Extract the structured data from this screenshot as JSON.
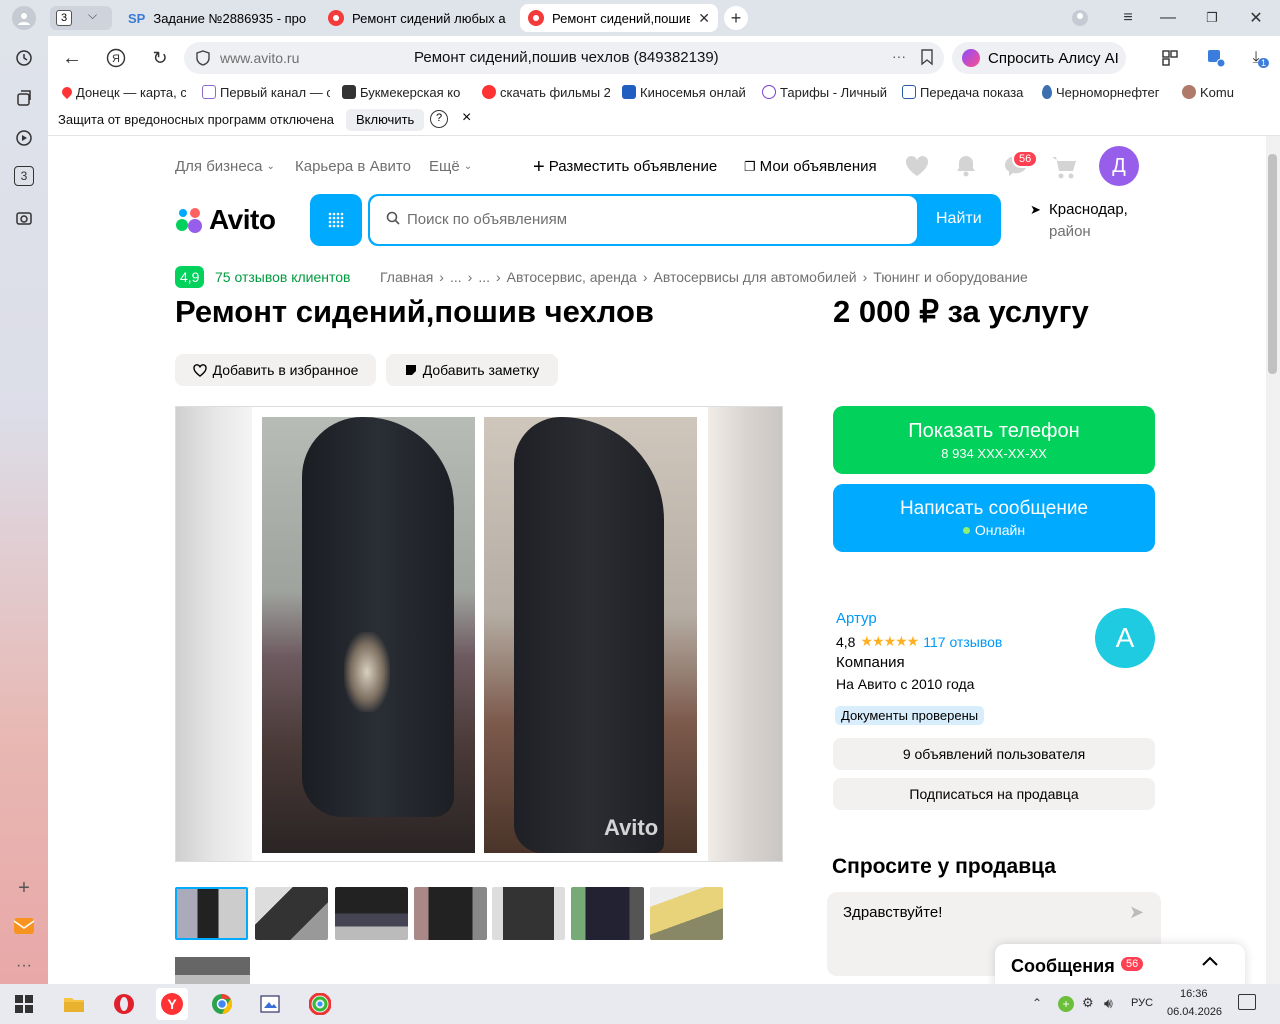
{
  "tabs": {
    "count": "3",
    "items": [
      {
        "icon": "SP",
        "label": "Задание №2886935 - про"
      },
      {
        "label": "Ремонт сидений любых а"
      },
      {
        "label": "Ремонт сидений,пошив"
      }
    ]
  },
  "address": {
    "domain": "www.avito.ru",
    "title": "Ремонт сидений,пошив чехлов (849382139)",
    "alice": "Спросить Алису AI",
    "downloads_badge": "1"
  },
  "bookmarks": [
    "Донецк — карта, с",
    "Первый канал — с",
    "Букмекерская ко",
    "скачать фильмы 2",
    "Киносемья онлай",
    "Тарифы - Личный",
    "Передача показа",
    "Черноморнефтег",
    "Komu"
  ],
  "notice": {
    "text": "Защита от вредоносных программ отключена",
    "button": "Включить",
    "help": "?",
    "close": "×"
  },
  "rail": {
    "badge": "3"
  },
  "site": {
    "nav": {
      "business": "Для бизнеса",
      "career": "Карьера в Авито",
      "more": "Ещё",
      "post": "Разместить объявление",
      "my_ads": "Мои объявления",
      "messages_badge": "56",
      "avatar": "Д"
    },
    "logo": "Avito",
    "search_placeholder": "Поиск по объявлениям",
    "search_button": "Найти",
    "location_line1": "Краснодар,",
    "location_line2": "район"
  },
  "rating": {
    "score": "4,9",
    "reviews": "75 отзывов клиентов"
  },
  "breadcrumbs": [
    "Главная",
    "...",
    "...",
    "Автосервис, аренда",
    "Автосервисы для автомобилей",
    "Тюнинг и оборудование"
  ],
  "ad": {
    "title": "Ремонт сидений,пошив чехлов",
    "price": "2 000 ₽ за услугу",
    "fav_button": "Добавить в избранное",
    "note_button": "Добавить заметку",
    "watermark": "Avito"
  },
  "contact": {
    "phone_button": "Показать телефон",
    "phone_masked": "8 934 XXX-XX-XX",
    "message_button": "Написать сообщение",
    "online": "Онлайн"
  },
  "seller": {
    "name": "Артур",
    "rating": "4,8",
    "stars": "★★★★★",
    "reviews": "117 отзывов",
    "type": "Компания",
    "since": "На Авито с 2010 года",
    "badge": "Документы проверены",
    "avatar": "А",
    "ads_button": "9 объявлений пользователя",
    "subscribe_button": "Подписаться на продавца"
  },
  "ask": {
    "title": "Спросите у продавца",
    "message": "Здравствуйте!"
  },
  "messages_panel": {
    "label": "Сообщения",
    "badge": "56"
  },
  "taskbar": {
    "lang": "РУС",
    "time": "16:36",
    "date": "06.04.2026"
  },
  "colors": {
    "avito_green": "#02d15c",
    "avito_blue": "#00aaff",
    "link": "#0099f7",
    "brand_purple": "#965eeb"
  }
}
